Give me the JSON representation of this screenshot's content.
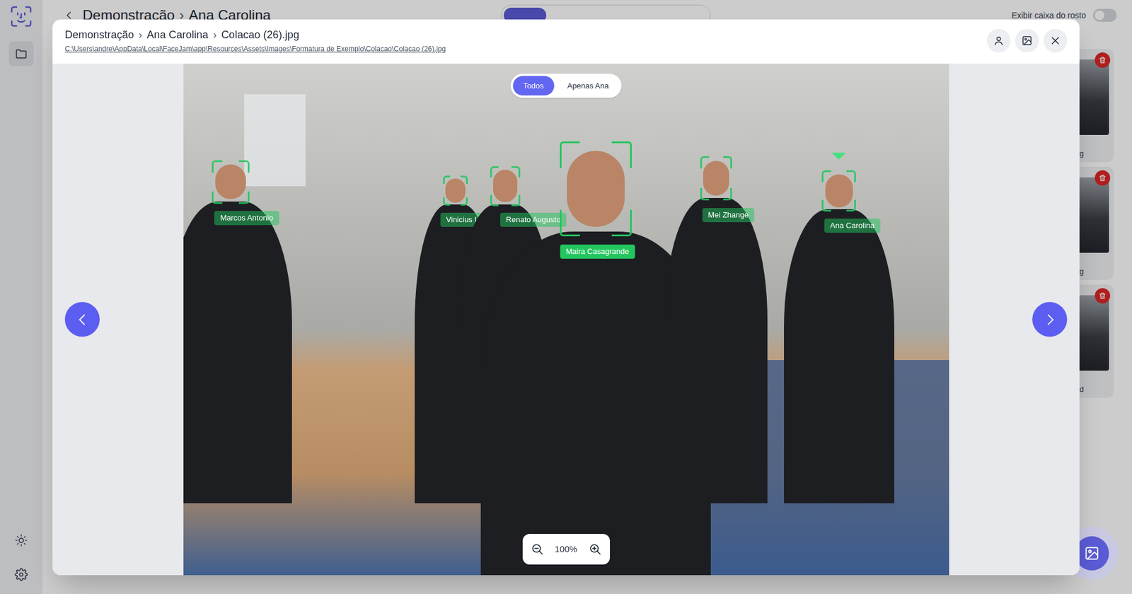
{
  "sidebar": {
    "items": [
      {
        "selected": true
      }
    ]
  },
  "background": {
    "breadcrumb": [
      "Demonstração",
      "Ana Carolina"
    ],
    "separator": "›",
    "toggle": {
      "label": "Exibir caixa do rosto",
      "on": false
    },
    "thumbnails": [
      {
        "filename": "g"
      },
      {
        "filename": "g"
      },
      {
        "filename": "d"
      }
    ]
  },
  "viewer": {
    "breadcrumb": [
      "Demonstração",
      "Ana Carolina",
      "Colacao (26).jpg"
    ],
    "separator": "›",
    "path": "C:\\Users\\andre\\AppData\\Local\\FaceJam\\app\\Resources\\Assets\\Images\\Formatura de Exemplo\\Colacao\\Colacao (26).jpg",
    "filter": [
      {
        "label": "Todos",
        "selected": true
      },
      {
        "label": "Apenas Ana",
        "selected": false
      }
    ],
    "faces": [
      {
        "name": "Marcos Antonio",
        "highlighted": false,
        "target": false
      },
      {
        "name": "Vinicius Lima",
        "highlighted": false,
        "target": false
      },
      {
        "name": "Renato Augusto",
        "highlighted": false,
        "target": false
      },
      {
        "name": "Maira Casagrande",
        "highlighted": true,
        "target": false
      },
      {
        "name": "Mei Zhange",
        "highlighted": false,
        "target": false
      },
      {
        "name": "Ana Carolina",
        "highlighted": false,
        "target": true
      }
    ],
    "zoom": "100%"
  }
}
